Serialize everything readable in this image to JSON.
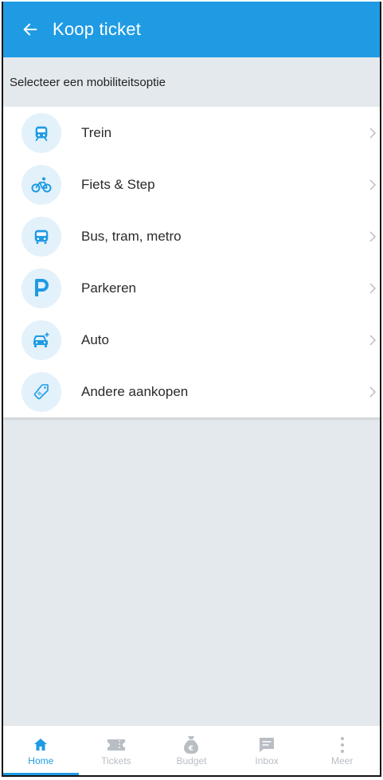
{
  "header": {
    "title": "Koop ticket"
  },
  "subheader": "Selecteer een mobiliteitsoptie",
  "options": [
    {
      "label": "Trein",
      "icon": "train-icon"
    },
    {
      "label": "Fiets & Step",
      "icon": "bike-icon"
    },
    {
      "label": "Bus, tram, metro",
      "icon": "bus-icon"
    },
    {
      "label": "Parkeren",
      "icon": "parking-icon"
    },
    {
      "label": "Auto",
      "icon": "car-icon"
    },
    {
      "label": "Andere aankopen",
      "icon": "tag-icon"
    }
  ],
  "nav": [
    {
      "label": "Home",
      "icon": "home-icon",
      "active": true
    },
    {
      "label": "Tickets",
      "icon": "ticket-icon",
      "active": false
    },
    {
      "label": "Budget",
      "icon": "money-bag-icon",
      "active": false
    },
    {
      "label": "Inbox",
      "icon": "chat-icon",
      "active": false
    },
    {
      "label": "Meer",
      "icon": "more-icon",
      "active": false
    }
  ],
  "colors": {
    "primary": "#1f9be4",
    "iconBg": "#e3f1fb",
    "page": "#e4e9ed",
    "inactive": "#b9bec4"
  }
}
